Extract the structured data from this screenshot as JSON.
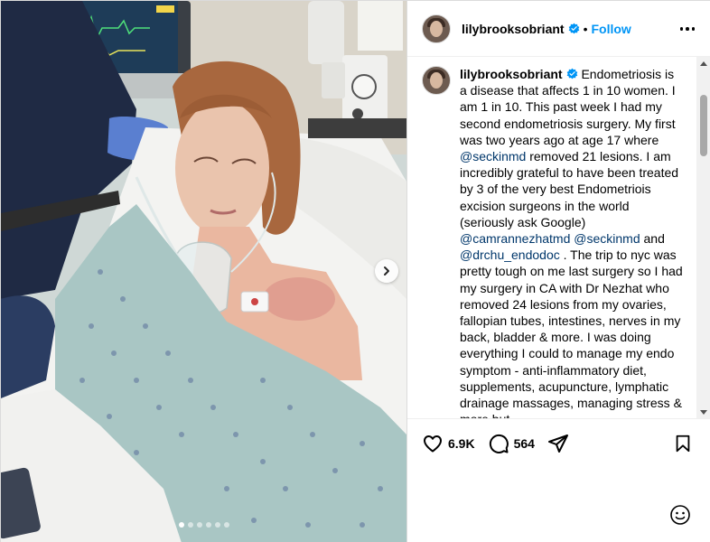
{
  "post": {
    "username": "lilybrooksobriant",
    "follow_label": "Follow",
    "separator": "•"
  },
  "caption": {
    "username": "lilybrooksobriant",
    "text_1": " Endometriosis is a disease that affects 1 in 10 women. I am 1 in 10. This past week I had my second endometriosis surgery. My first was two years ago at age 17 where ",
    "mention_1": "@seckinmd",
    "text_2": " removed 21 lesions. I am incredibly grateful to have been treated by 3 of the very best Endometriois excision surgeons in the world (seriously ask Google) ",
    "mention_2": "@camrannezhatmd",
    "text_3": " ",
    "mention_3": "@seckinmd",
    "text_4": " and ",
    "mention_4": "@drchu_endodoc",
    "text_5": " . The trip to nyc was pretty tough on me last surgery so I had my surgery in CA with Dr Nezhat who removed 24 lesions from my ovaries, fallopian tubes, intestines, nerves in my back, bladder & more. I was doing everything I could to manage my endo symptom - anti-inflammatory diet, supplements, acupuncture, lymphatic drainage massages, managing stress & more but"
  },
  "actions": {
    "likes": "6.9K",
    "comments": "564"
  },
  "carousel": {
    "total": 6,
    "current": 1
  },
  "icons": {
    "verified": "verified-badge-icon",
    "more": "more-options-icon",
    "like": "heart-icon",
    "comment": "comment-icon",
    "share": "share-icon",
    "save": "bookmark-icon",
    "next": "chevron-right-icon",
    "emoji": "emoji-icon"
  },
  "colors": {
    "follow": "#0095f6",
    "mention": "#00376b",
    "verified": "#0095f6"
  }
}
